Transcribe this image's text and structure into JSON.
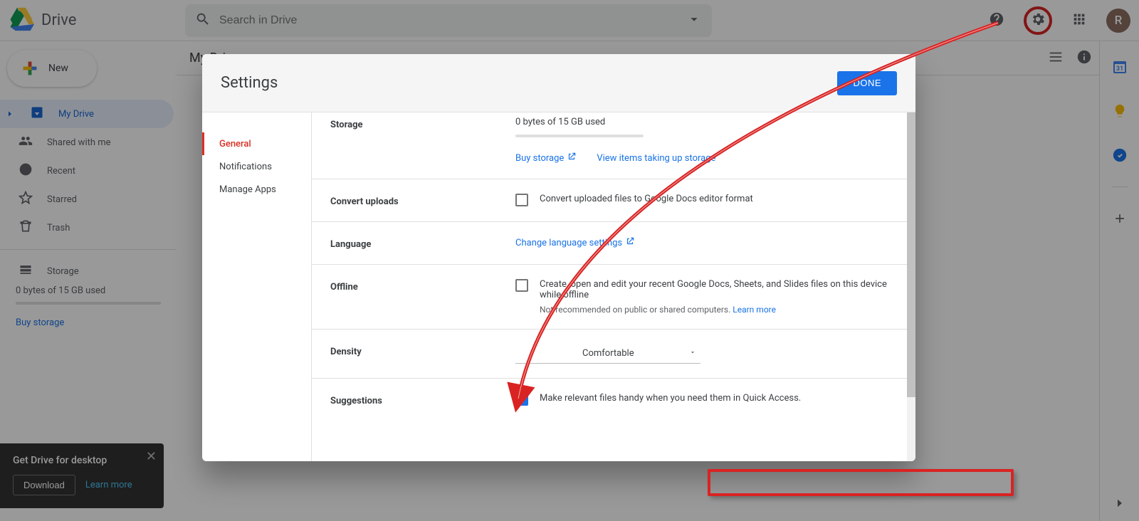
{
  "app": {
    "name": "Drive",
    "search_placeholder": "Search in Drive"
  },
  "avatar": {
    "initial": "R"
  },
  "new_btn": "New",
  "sidebar": {
    "items": [
      {
        "label": "My Drive"
      },
      {
        "label": "Shared with me"
      },
      {
        "label": "Recent"
      },
      {
        "label": "Starred"
      },
      {
        "label": "Trash"
      }
    ],
    "storage_label": "Storage",
    "storage_text": "0 bytes of 15 GB used",
    "buy_storage": "Buy storage"
  },
  "content": {
    "title": "My Drive"
  },
  "card": {
    "title": "Get Drive for desktop",
    "download": "Download",
    "learn": "Learn more"
  },
  "dialog": {
    "title": "Settings",
    "done": "DONE",
    "nav": [
      "General",
      "Notifications",
      "Manage Apps"
    ],
    "sections": {
      "storage": {
        "label": "Storage",
        "used": "0 bytes of 15 GB used",
        "buy": "Buy storage",
        "view_items": "View items taking up storage"
      },
      "convert": {
        "label": "Convert uploads",
        "text": "Convert uploaded files to Google Docs editor format"
      },
      "language": {
        "label": "Language",
        "link": "Change language settings"
      },
      "offline": {
        "label": "Offline",
        "text": "Create, open and edit your recent Google Docs, Sheets, and Slides files on this device while offline",
        "note": "Not recommended on public or shared computers. ",
        "learn": "Learn more"
      },
      "density": {
        "label": "Density",
        "value": "Comfortable"
      },
      "suggestions": {
        "label": "Suggestions",
        "text": "Make relevant files handy when you need them in Quick Access."
      }
    }
  },
  "rail": {
    "calendar_day": "31"
  }
}
